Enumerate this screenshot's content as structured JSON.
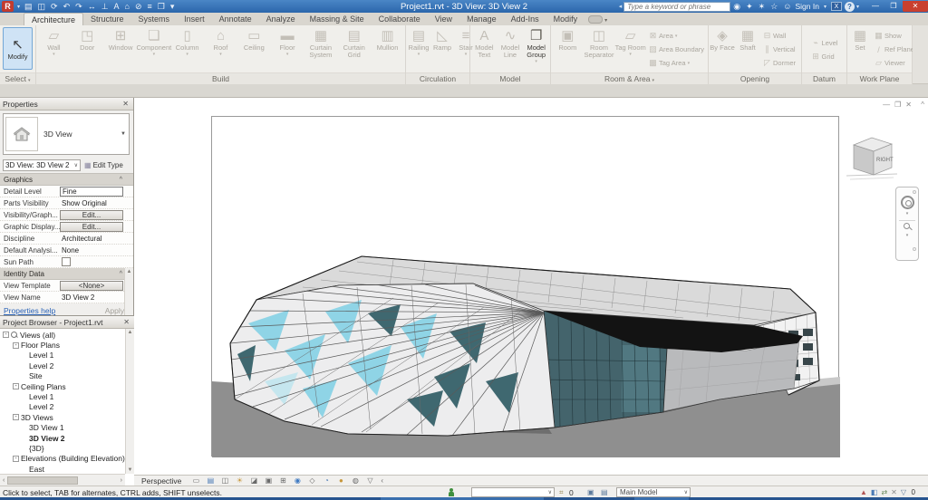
{
  "colors": {
    "titlebar_blue": "#2b66ab",
    "close_red": "#c9402f",
    "modify_highlight": "#cfe3f5",
    "glass_teal": "#44646c",
    "glass_light_blue": "#8fd4e6",
    "ground_gray": "#8f8f8f",
    "link_blue": "#2a63b8"
  },
  "title_bar": {
    "title": "Project1.rvt - 3D View: 3D View 2",
    "search_placeholder": "Type a keyword or phrase",
    "sign_in_label": "Sign In",
    "exchange_glyph": "X",
    "help_glyph": "?",
    "qat_icons": [
      {
        "name": "open-icon",
        "glyph": "▤"
      },
      {
        "name": "save-icon",
        "glyph": "◫"
      },
      {
        "name": "sync-icon",
        "glyph": "⟳"
      },
      {
        "name": "undo-icon",
        "glyph": "↶"
      },
      {
        "name": "redo-icon",
        "glyph": "↷"
      },
      {
        "name": "measure-icon",
        "glyph": "↔"
      },
      {
        "name": "aligned-dimension-icon",
        "glyph": "⊥"
      },
      {
        "name": "text-icon",
        "glyph": "A"
      },
      {
        "name": "default-3d-view-icon",
        "glyph": "⌂"
      },
      {
        "name": "section-icon",
        "glyph": "⊘"
      },
      {
        "name": "thin-lines-icon",
        "glyph": "≡"
      },
      {
        "name": "switch-windows-icon",
        "glyph": "❐"
      },
      {
        "name": "qat-customize-caret",
        "glyph": "▾"
      }
    ],
    "info_icons": [
      {
        "name": "search-icon",
        "glyph": "◉"
      },
      {
        "name": "communication-center-icon",
        "glyph": "✦"
      },
      {
        "name": "subscription-center-icon",
        "glyph": "✶"
      },
      {
        "name": "favorites-icon",
        "glyph": "☆"
      },
      {
        "name": "signin-person-icon",
        "glyph": "☺"
      }
    ],
    "window_controls": {
      "minimize": "—",
      "maximize": "❐",
      "close": "✕"
    }
  },
  "tabs": [
    {
      "label": "Architecture",
      "cls": "active"
    },
    {
      "label": "Structure"
    },
    {
      "label": "Systems"
    },
    {
      "label": "Insert"
    },
    {
      "label": "Annotate"
    },
    {
      "label": "Analyze"
    },
    {
      "label": "Massing & Site"
    },
    {
      "label": "Collaborate"
    },
    {
      "label": "View"
    },
    {
      "label": "Manage"
    },
    {
      "label": "Add-Ins"
    },
    {
      "label": "Modify"
    }
  ],
  "ribbon": {
    "select": {
      "label": "Select",
      "modify_label": "Modify"
    },
    "build": {
      "label": "Build",
      "buttons": [
        {
          "label": "Wall",
          "icon": "▱",
          "arrow": true
        },
        {
          "label": "Door",
          "icon": "◳"
        },
        {
          "label": "Window",
          "icon": "⊞"
        },
        {
          "label": "Component",
          "icon": "❏",
          "arrow": true
        },
        {
          "label": "Column",
          "icon": "▯",
          "arrow": true
        },
        {
          "label": "Roof",
          "icon": "⌂",
          "arrow": true
        },
        {
          "label": "Ceiling",
          "icon": "▭"
        },
        {
          "label": "Floor",
          "icon": "▬",
          "arrow": true
        },
        {
          "label": "Curtain System",
          "icon": "▦"
        },
        {
          "label": "Curtain Grid",
          "icon": "▤"
        },
        {
          "label": "Mullion",
          "icon": "▥"
        }
      ]
    },
    "circulation": {
      "label": "Circulation",
      "buttons": [
        {
          "label": "Railing",
          "icon": "▤",
          "arrow": true
        },
        {
          "label": "Ramp",
          "icon": "◺"
        },
        {
          "label": "Stair",
          "icon": "≡",
          "arrow": true
        }
      ]
    },
    "model": {
      "label": "Model",
      "buttons": [
        {
          "label": "Model Text",
          "icon": "A"
        },
        {
          "label": "Model Line",
          "icon": "∿"
        },
        {
          "label": "Model Group",
          "icon": "❐",
          "arrow": true,
          "cls": "enabled"
        }
      ]
    },
    "room_area": {
      "label": "Room & Area",
      "buttons": [
        {
          "label": "Room",
          "icon": "▣"
        },
        {
          "label": "Room Separator",
          "icon": "◫"
        },
        {
          "label": "Tag Room",
          "icon": "▱",
          "arrow": true
        }
      ],
      "stack": [
        {
          "label": "Area",
          "icon": "⊠",
          "arrow": true
        },
        {
          "label": "Area Boundary",
          "icon": "▨"
        },
        {
          "label": "Tag Area",
          "icon": "▩",
          "arrow": true
        }
      ]
    },
    "opening": {
      "label": "Opening",
      "buttons": [
        {
          "label": "By Face",
          "icon": "◈"
        },
        {
          "label": "Shaft",
          "icon": "▦"
        }
      ],
      "stack": [
        {
          "label": "Wall",
          "icon": "⊟"
        },
        {
          "label": "Vertical",
          "icon": "∥"
        },
        {
          "label": "Dormer",
          "icon": "◸"
        }
      ]
    },
    "datum": {
      "label": "Datum",
      "stack": [
        {
          "label": "Level",
          "icon": "⌁"
        },
        {
          "label": "Grid",
          "icon": "⊞"
        }
      ]
    },
    "work_plane": {
      "label": "Work Plane",
      "buttons": [
        {
          "label": "Set",
          "icon": "▦"
        }
      ],
      "stack": [
        {
          "label": "Show",
          "icon": "▦"
        },
        {
          "label": "Ref Plane",
          "icon": "/"
        },
        {
          "label": "Viewer",
          "icon": "▱"
        }
      ]
    }
  },
  "properties": {
    "header": "Properties",
    "type_label": "3D View",
    "instance_selector": "3D View: 3D View 2",
    "edit_type_label": "Edit Type",
    "rows": [
      {
        "label": "Graphics",
        "cls": "section"
      },
      {
        "label": "Detail Level",
        "value": "Fine",
        "cls": "input"
      },
      {
        "label": "Parts Visibility",
        "value": "Show Original",
        "cls": "plain"
      },
      {
        "label": "Visibility/Graph...",
        "value": "Edit...",
        "cls": "button"
      },
      {
        "label": "Graphic Display...",
        "value": "Edit...",
        "cls": "button"
      },
      {
        "label": "Discipline",
        "value": "Architectural",
        "cls": "plain"
      },
      {
        "label": "Default Analysi...",
        "value": "None",
        "cls": "plain"
      },
      {
        "label": "Sun Path",
        "value": "",
        "cls": "checkbox"
      },
      {
        "label": "Identity Data",
        "cls": "section"
      },
      {
        "label": "View Template",
        "value": "<None>",
        "cls": "button"
      },
      {
        "label": "View Name",
        "value": "3D View 2",
        "cls": "plain"
      }
    ],
    "help_link": "Properties help",
    "apply_label": "Apply"
  },
  "project_browser": {
    "header": "Project Browser - Project1.rvt",
    "items": [
      {
        "label": "Views (all)",
        "cls": "d0",
        "pre": "-",
        "icon": true
      },
      {
        "label": "Floor Plans",
        "cls": "d1",
        "pre": "-"
      },
      {
        "label": "Level 1",
        "cls": "d2"
      },
      {
        "label": "Level 2",
        "cls": "d2"
      },
      {
        "label": "Site",
        "cls": "d2"
      },
      {
        "label": "Ceiling Plans",
        "cls": "d1",
        "pre": "-"
      },
      {
        "label": "Level 1",
        "cls": "d2"
      },
      {
        "label": "Level 2",
        "cls": "d2"
      },
      {
        "label": "3D Views",
        "cls": "d1",
        "pre": "-"
      },
      {
        "label": "3D View 1",
        "cls": "d2"
      },
      {
        "label": "3D View 2",
        "cls": "d2 bold"
      },
      {
        "label": "{3D}",
        "cls": "d2"
      },
      {
        "label": "Elevations (Building Elevation)",
        "cls": "d1",
        "pre": "-"
      },
      {
        "label": "East",
        "cls": "d2"
      }
    ]
  },
  "viewport": {
    "window_controls": {
      "minimize": "—",
      "restore": "❐",
      "close": "✕",
      "collapse": "^"
    },
    "viewcube_right_label": "RIGHT"
  },
  "view_control_bar": {
    "view_type": "Perspective",
    "collapse_glyph": "‹",
    "icons": [
      {
        "name": "view-scale-icon",
        "glyph": "▭",
        "style_color": "#6a6a6a"
      },
      {
        "name": "detail-level-icon",
        "glyph": "▤",
        "style_color": "#4a7ab5"
      },
      {
        "name": "visual-style-icon",
        "glyph": "◫",
        "style_color": "#6a6a6a"
      },
      {
        "name": "sun-path-icon",
        "glyph": "☀",
        "style_color": "#c7973b"
      },
      {
        "name": "shadows-icon",
        "glyph": "◪",
        "style_color": "#6a6a6a"
      },
      {
        "name": "crop-view-icon",
        "glyph": "▣",
        "style_color": "#6a6a6a"
      },
      {
        "name": "show-crop-region-icon",
        "glyph": "⊞",
        "style_color": "#6a6a6a"
      },
      {
        "name": "render-icon",
        "glyph": "◉",
        "style_color": "#3f7ac2"
      },
      {
        "name": "lock-view-icon",
        "glyph": "◇",
        "style_color": "#6a6a6a"
      },
      {
        "name": "hide-isolate-icon",
        "glyph": "◔",
        "style_color": "#4a7ab5"
      },
      {
        "name": "reveal-hidden-icon",
        "glyph": "●",
        "style_color": "#c7973b"
      },
      {
        "name": "worksharing-display-icon",
        "glyph": "◍",
        "style_color": "#6a6a6a"
      },
      {
        "name": "view-properties-icon",
        "glyph": "▽",
        "style_color": "#6a6a6a"
      }
    ]
  },
  "status_bar": {
    "hint": "Click to select, TAB for alternates, CTRL adds, SHIFT unselects.",
    "workset_icon": "⌗",
    "workset_count": "0",
    "active_model_label": "Main Model",
    "design_option_icons": [
      "▣",
      "▤"
    ],
    "right_icons": [
      {
        "name": "select-links-icon",
        "glyph": "▲",
        "style_color": "#b05555"
      },
      {
        "name": "select-underlay-icon",
        "glyph": "◧",
        "style_color": "#4a7ab5"
      },
      {
        "name": "select-pinned-icon",
        "glyph": "⇄",
        "style_color": "#6a8a5a"
      },
      {
        "name": "drag-on-selection-icon",
        "glyph": "✕",
        "style_color": "#8a8a8a"
      },
      {
        "name": "filter-icon",
        "glyph": "▽",
        "style_color": "#5a789a"
      }
    ],
    "filter_count": "0"
  }
}
